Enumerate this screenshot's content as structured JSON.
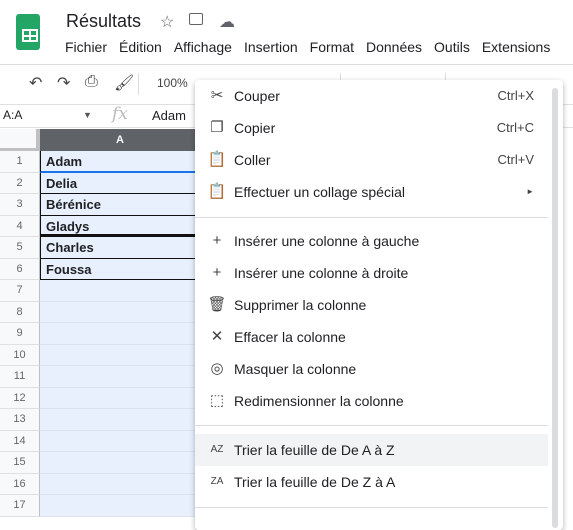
{
  "app": {
    "title": "Résultats",
    "icons": [
      "star-icon",
      "move-to-folder-icon",
      "cloud-saved-icon"
    ]
  },
  "menubar": [
    "Fichier",
    "Édition",
    "Affichage",
    "Insertion",
    "Format",
    "Données",
    "Outils",
    "Extensions"
  ],
  "toolbar": {
    "zoom": "100%"
  },
  "formula": {
    "namebox": "A:A",
    "fx": "fx",
    "value": "Adam"
  },
  "sheet": {
    "column": "A",
    "rows": [
      "1",
      "2",
      "3",
      "4",
      "5",
      "6",
      "7",
      "8",
      "9",
      "10",
      "11",
      "12",
      "13",
      "14",
      "15",
      "16",
      "17"
    ],
    "cells": [
      "Adam",
      "Delia",
      "Bérénice",
      "Gladys",
      "Charles",
      "Foussa"
    ]
  },
  "context_menu": {
    "items": [
      {
        "label": "Couper",
        "shortcut": "Ctrl+X",
        "icon": "scissors-icon"
      },
      {
        "label": "Copier",
        "shortcut": "Ctrl+C",
        "icon": "copy-icon"
      },
      {
        "label": "Coller",
        "shortcut": "Ctrl+V",
        "icon": "paste-icon"
      },
      {
        "label": "Effectuer un collage spécial",
        "shortcut": "►",
        "icon": "paste-special-icon"
      },
      {
        "label": "Insérer une colonne à gauche",
        "icon": "plus-icon"
      },
      {
        "label": "Insérer une colonne à droite",
        "icon": "plus-icon"
      },
      {
        "label": "Supprimer la colonne",
        "icon": "trash-icon"
      },
      {
        "label": "Effacer la colonne",
        "icon": "close-icon"
      },
      {
        "label": "Masquer la colonne",
        "icon": "eye-off-icon"
      },
      {
        "label": "Redimensionner la colonne",
        "icon": "resize-icon"
      },
      {
        "label": "Trier la feuille de De A à Z",
        "icon": "sort-az-icon",
        "highlighted": true
      },
      {
        "label": "Trier la feuille de De Z à A",
        "icon": "sort-za-icon"
      }
    ]
  },
  "colors": {
    "sheets_green": "#23a566",
    "selection": "#e8f0fe",
    "header_selected": "#5f6368",
    "hover": "#f1f3f4"
  }
}
